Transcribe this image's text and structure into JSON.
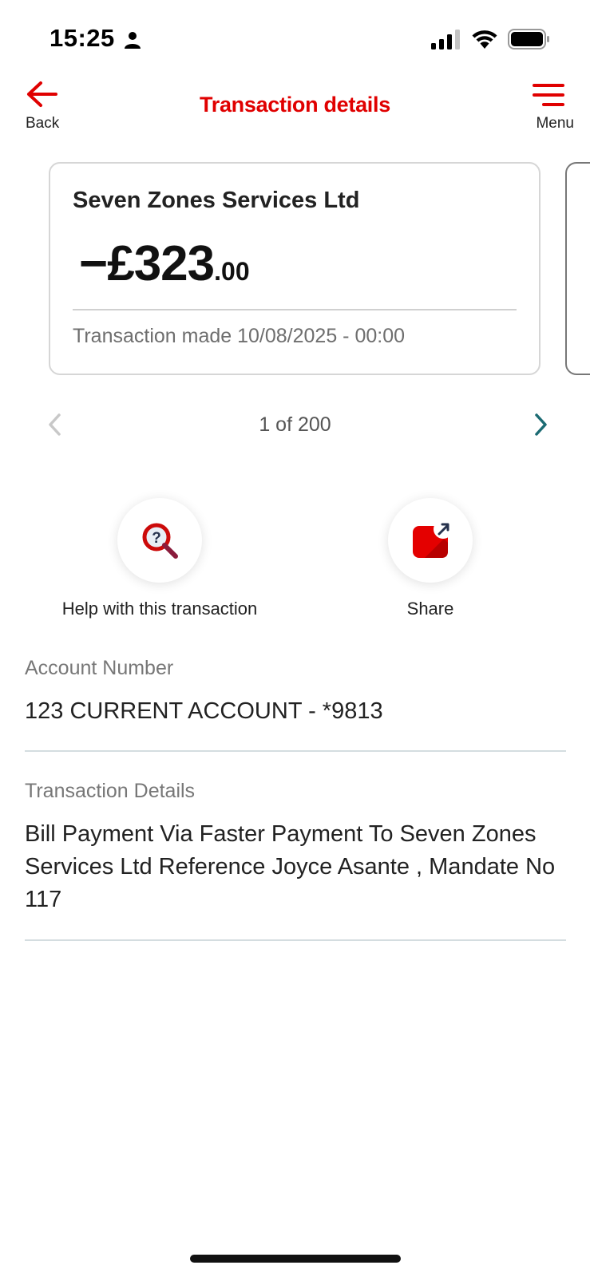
{
  "status_bar": {
    "time": "15:25"
  },
  "header": {
    "back_label": "Back",
    "title": "Transaction details",
    "menu_label": "Menu"
  },
  "card": {
    "merchant": "Seven Zones Services Ltd",
    "amount_main": "−£323",
    "amount_pence": ".00",
    "date_line": "Transaction made 10/08/2025 - 00:00"
  },
  "pager": {
    "text": "1 of 200"
  },
  "actions": {
    "help_label": "Help with this transaction",
    "share_label": "Share"
  },
  "details": {
    "account_label": "Account Number",
    "account_value": "123 CURRENT ACCOUNT - *9813",
    "transaction_label": "Transaction Details",
    "transaction_value": "Bill Payment Via Faster Payment To Seven Zones Services Ltd Reference Joyce Asante , Mandate No 117"
  },
  "colors": {
    "brand_red": "#e00000",
    "pager_active": "#1c6b73"
  }
}
